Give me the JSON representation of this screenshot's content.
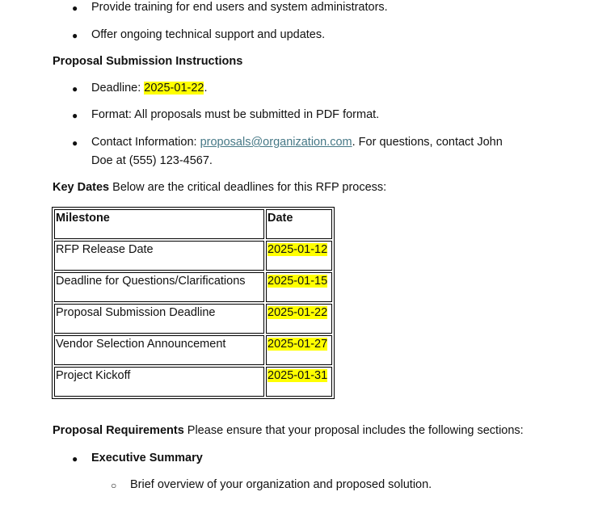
{
  "top_bullets": [
    "Provide training for end users and system administrators.",
    "Offer ongoing technical support and updates."
  ],
  "submission": {
    "heading": "Proposal Submission Instructions",
    "deadline_label": "Deadline: ",
    "deadline": "2025-01-22",
    "deadline_end": ".",
    "format": "Format: All proposals must be submitted in PDF format.",
    "contact_label": "Contact Information: ",
    "email": "proposals@organization.com",
    "contact_rest1": ". For questions, contact John",
    "contact_rest2": "Doe at (555) 123-4567."
  },
  "key_dates": {
    "heading": "Key Dates",
    "text": " Below are the critical deadlines for this RFP process:"
  },
  "table": {
    "headers": [
      "Milestone",
      "Date"
    ],
    "rows": [
      [
        "RFP Release Date",
        "2025-01-12"
      ],
      [
        "Deadline for Questions/Clarifications",
        "2025-01-15"
      ],
      [
        "Proposal Submission Deadline",
        "2025-01-22"
      ],
      [
        "Vendor Selection Announcement",
        "2025-01-27"
      ],
      [
        "Project Kickoff",
        "2025-01-31"
      ]
    ]
  },
  "requirements": {
    "heading": "Proposal Requirements",
    "text": " Please ensure that your proposal includes the following sections:",
    "item": "Executive Summary",
    "sub": "Brief overview of your organization and proposed solution."
  },
  "colors": {
    "highlight": "#ffff00",
    "link": "#467886"
  }
}
